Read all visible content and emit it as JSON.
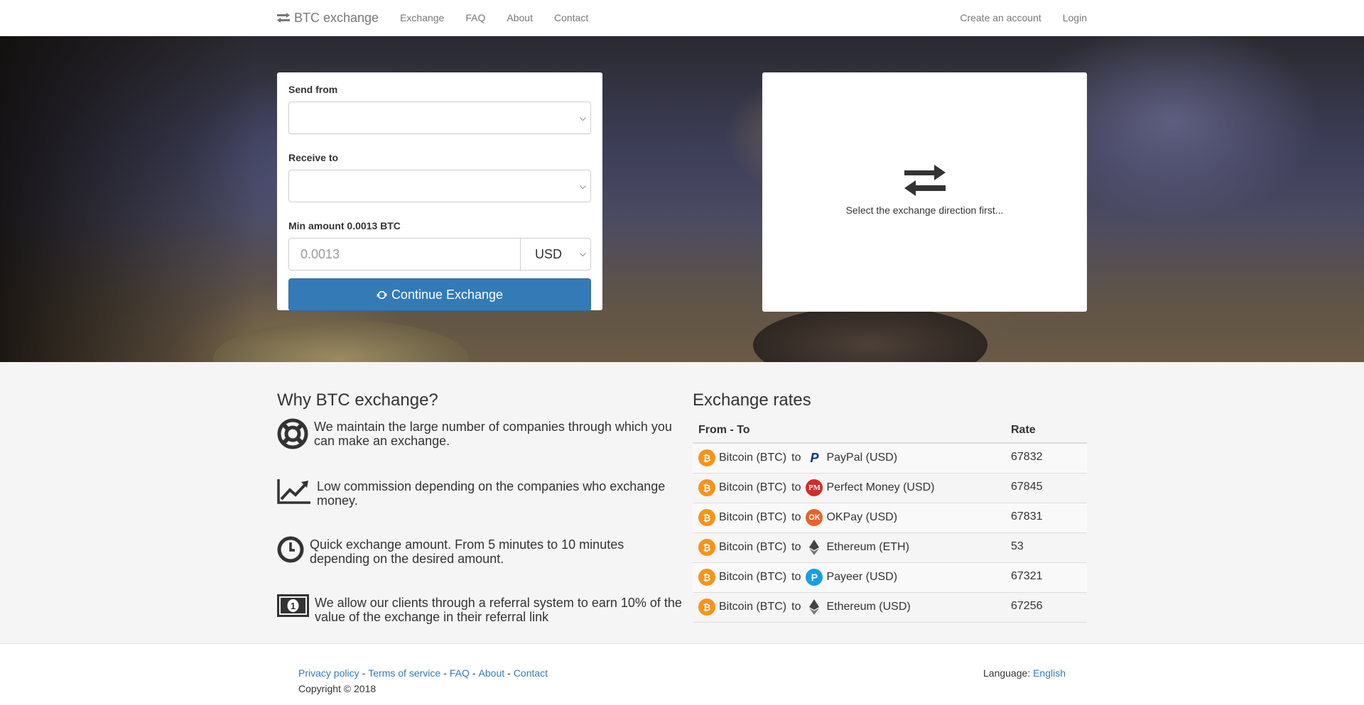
{
  "nav": {
    "brand": "BTC exchange",
    "links": [
      "Exchange",
      "FAQ",
      "About",
      "Contact"
    ],
    "create_account": "Create an account",
    "login": "Login"
  },
  "form": {
    "send_from_label": "Send from",
    "receive_to_label": "Receive to",
    "min_amount_label": "Min amount 0.0013 BTC",
    "amount_placeholder": "0.0013",
    "currency": "USD",
    "continue_button": "Continue Exchange"
  },
  "info": {
    "message": "Select the exchange direction first..."
  },
  "why": {
    "title": "Why BTC exchange?",
    "features": [
      {
        "icon": "lifebuoy-icon",
        "text": "We maintain the large number of companies through which you can make an exchange."
      },
      {
        "icon": "chart-line-icon",
        "text": "Low commission depending on the companies who exchange money."
      },
      {
        "icon": "clock-icon",
        "text": "Quick exchange amount. From 5 minutes to 10 minutes depending on the desired amount."
      },
      {
        "icon": "money-bill-icon",
        "text": "We allow our clients through a referral system to earn 10% of the value of the exchange in their referral link"
      }
    ]
  },
  "rates": {
    "title": "Exchange rates",
    "col_from_to": "From - To",
    "col_rate": "Rate",
    "rows": [
      {
        "from": "Bitcoin (BTC)",
        "to_word": "to",
        "to": "PayPal (USD)",
        "to_icon": "paypal-icon",
        "rate": "67832"
      },
      {
        "from": "Bitcoin (BTC)",
        "to_word": "to",
        "to": "Perfect Money (USD)",
        "to_icon": "perfect-money-icon",
        "rate": "67845"
      },
      {
        "from": "Bitcoin (BTC)",
        "to_word": "to",
        "to": "OKPay (USD)",
        "to_icon": "okpay-icon",
        "rate": "67831"
      },
      {
        "from": "Bitcoin (BTC)",
        "to_word": "to",
        "to": "Ethereum (ETH)",
        "to_icon": "ethereum-icon",
        "rate": "53"
      },
      {
        "from": "Bitcoin (BTC)",
        "to_word": "to",
        "to": "Payeer (USD)",
        "to_icon": "payeer-icon",
        "rate": "67321"
      },
      {
        "from": "Bitcoin (BTC)",
        "to_word": "to",
        "to": "Ethereum (USD)",
        "to_icon": "ethereum-icon",
        "rate": "67256"
      }
    ]
  },
  "footer": {
    "links": [
      "Privacy policy",
      "Terms of service",
      "FAQ",
      "About",
      "Contact"
    ],
    "separator": "-",
    "copyright": "Copyright © 2018",
    "language_label": "Language:",
    "language": "English"
  },
  "colors": {
    "primary": "#337ab7",
    "bitcoin": "#f7931a"
  }
}
